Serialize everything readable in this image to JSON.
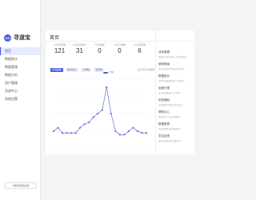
{
  "app": {
    "logo_text": "寻道宝",
    "logo_mark": "GG"
  },
  "sidebar": {
    "items": [
      {
        "label": "首页",
        "active": true
      },
      {
        "label": "数据统计"
      },
      {
        "label": "数据管理"
      },
      {
        "label": "数据分析"
      },
      {
        "label": "用户管理"
      },
      {
        "label": "资源中心"
      },
      {
        "label": "系统设置"
      }
    ],
    "footer_button": "切换到旧版系统"
  },
  "main": {
    "title": "首页",
    "stats": [
      {
        "label": "今日访问量",
        "value": "121"
      },
      {
        "label": "今日新增用户",
        "value": "31"
      },
      {
        "label": "今日数据",
        "value": "0"
      },
      {
        "label": "今日订单数",
        "value": "0"
      },
      {
        "label": "今日活跃量",
        "value": "6"
      }
    ],
    "tabs": [
      {
        "label": "访问趋势",
        "active": true
      },
      {
        "label": "新增用户"
      },
      {
        "label": "订单数"
      },
      {
        "label": "活跃量"
      }
    ],
    "legend_label": "访问量",
    "chart_note": "近30天访问趋势"
  },
  "panel": {
    "items": [
      {
        "title": "活动数据",
        "sub": "数据统计显示最近一周活动情况"
      },
      {
        "title": "使用指南",
        "sub": "快速了解系统功能和使用方法"
      },
      {
        "title": "数据统计",
        "sub": "查看系统数据和统计分析报告"
      },
      {
        "title": "运营日报",
        "sub": "每日运营数据汇总与趋势"
      },
      {
        "title": "系统通知",
        "sub": "查看最新的系统消息和公告"
      },
      {
        "title": "帮助中心",
        "sub": "获取帮助与常见问题解答"
      },
      {
        "title": "数据报表",
        "sub": "导出和查看各类数据报表"
      },
      {
        "title": "意见反馈",
        "sub": "提交您的建议和问题反馈"
      }
    ]
  },
  "colors": {
    "accent": "#4a5bd6",
    "sidebar_active_bg": "#e8ecfd",
    "background": "#f3f4f6"
  },
  "chart_data": {
    "type": "line",
    "x": [
      1,
      2,
      3,
      4,
      5,
      6,
      7,
      8,
      9,
      10,
      11,
      12,
      13,
      14,
      15,
      16,
      17,
      18,
      19,
      20,
      21,
      22
    ],
    "series": [
      {
        "name": "访问量",
        "values": [
          10,
          12,
          9,
          9,
          9,
          9,
          12,
          14,
          15,
          18,
          20,
          22,
          35,
          20,
          10,
          8,
          8,
          10,
          12,
          10,
          9,
          9
        ]
      }
    ],
    "ylim": [
      0,
      40
    ],
    "grid": true
  }
}
